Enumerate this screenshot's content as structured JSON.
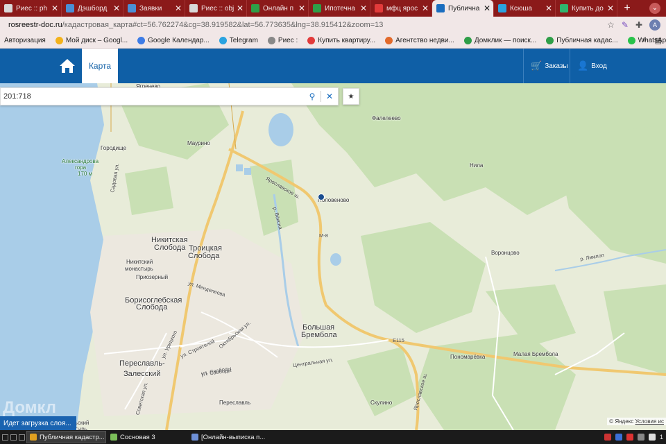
{
  "browser": {
    "tabs": [
      {
        "label": "Риес :: ph",
        "color": "#d9d9d9"
      },
      {
        "label": "Дэшборд",
        "color": "#4a8fd6"
      },
      {
        "label": "Заявки",
        "color": "#4a8fd6"
      },
      {
        "label": "Риес :: obj",
        "color": "#d9d9d9"
      },
      {
        "label": "Онлайн п",
        "color": "#2e9e48"
      },
      {
        "label": "Ипотечна",
        "color": "#2e9e48"
      },
      {
        "label": "мфц ярос",
        "color": "#e23b3b"
      },
      {
        "label": "Публична",
        "color": "#1a6dbf"
      },
      {
        "label": "Ксюша",
        "color": "#2aa3e0"
      },
      {
        "label": "Купить до",
        "color": "#2fb56e"
      }
    ],
    "active_tab_index": 7,
    "new_tab": "+",
    "profile_initial": "А",
    "url_host": "rosreestr-doc.ru",
    "url_path": "/кадастровая_карта#ct=56.762274&cg=38.919582&lat=56.773635&lng=38.915412&zoom=13",
    "bookmarks": [
      {
        "label": "Авторизация",
        "color": ""
      },
      {
        "label": "Мой диск – Googl...",
        "color": "#f3b21b"
      },
      {
        "label": "Google Календар...",
        "color": "#3d7ce6"
      },
      {
        "label": "Telegram",
        "color": "#2aa3e0"
      },
      {
        "label": "Риес :",
        "color": "#888888"
      },
      {
        "label": "Купить квартиру...",
        "color": "#e23b3b"
      },
      {
        "label": "Агентство недви...",
        "color": "#e26a2b"
      },
      {
        "label": "Домклик — поиск...",
        "color": "#2e9e48"
      },
      {
        "label": "Публичная кадас...",
        "color": "#2e9e48"
      },
      {
        "label": "WhatsApp",
        "color": "#28c24a"
      }
    ],
    "bookmarks_more": "»"
  },
  "header": {
    "map_tab": "Карта",
    "orders": "Заказы",
    "login": "Вход",
    "brand_color": "#0f5fa6"
  },
  "search": {
    "value": "201:718"
  },
  "map": {
    "places": [
      {
        "text": "Ягренево",
        "cls": ""
      },
      {
        "text": "Фалелеево",
        "cls": ""
      },
      {
        "text": "Городище",
        "cls": ""
      },
      {
        "text": "Маурино",
        "cls": ""
      },
      {
        "text": "Александрова",
        "cls": "green"
      },
      {
        "text": "гора",
        "cls": "green"
      },
      {
        "text": "170 м",
        "cls": "green"
      },
      {
        "text": "Нила",
        "cls": ""
      },
      {
        "text": "Половеново",
        "cls": ""
      },
      {
        "text": "Никитская",
        "cls": "big"
      },
      {
        "text": "Слобода",
        "cls": "big"
      },
      {
        "text": "Троицкая",
        "cls": "big"
      },
      {
        "text": "Слобода",
        "cls": "big"
      },
      {
        "text": "Воронцово",
        "cls": ""
      },
      {
        "text": "Никитский",
        "cls": ""
      },
      {
        "text": "монастырь",
        "cls": ""
      },
      {
        "text": "Приозерный",
        "cls": ""
      },
      {
        "text": "Борисоглебская",
        "cls": "big"
      },
      {
        "text": "Слобода",
        "cls": "big"
      },
      {
        "text": "Большая",
        "cls": "big"
      },
      {
        "text": "Брембола",
        "cls": "big"
      },
      {
        "text": "Пономарёвка",
        "cls": ""
      },
      {
        "text": "Малая Брембола",
        "cls": ""
      },
      {
        "text": "Переславль-",
        "cls": "big"
      },
      {
        "text": "Залесский",
        "cls": "big"
      },
      {
        "text": "Переславль",
        "cls": ""
      },
      {
        "text": "Скулино",
        "cls": ""
      },
      {
        "text": "Никольский",
        "cls": ""
      },
      {
        "text": "монастырь",
        "cls": ""
      }
    ],
    "roads": [
      {
        "text": "Ярославское ш."
      },
      {
        "text": "М-8"
      },
      {
        "text": "р. Вёксна"
      },
      {
        "text": "Садовая ул."
      },
      {
        "text": "ул. Менделеева"
      },
      {
        "text": "ул. Урицкого"
      },
      {
        "text": "ул. Строителей"
      },
      {
        "text": "Октябрьская ул."
      },
      {
        "text": "ул. Свободы"
      },
      {
        "text": "Центральная ул."
      },
      {
        "text": "ул. Свободы"
      },
      {
        "text": "Советская ул."
      },
      {
        "text": "Е115"
      },
      {
        "text": "Ярославское ш."
      },
      {
        "text": "р. Лимпоп"
      }
    ],
    "copyright_prefix": "© Яндекс",
    "copyright_link": "Условия ис",
    "watermark": "Домкл",
    "loading_text": "Идет загрузка слоя..."
  },
  "taskbar": {
    "items": [
      {
        "label": "Публичная кадастр...",
        "color": "#e0a020",
        "active": true
      },
      {
        "label": "Сосновая 3",
        "color": "#7cbf5a",
        "active": false
      },
      {
        "label": "[Онлайн-выписка п...",
        "color": "#6d8fd6",
        "active": false
      }
    ],
    "clock": "1"
  }
}
